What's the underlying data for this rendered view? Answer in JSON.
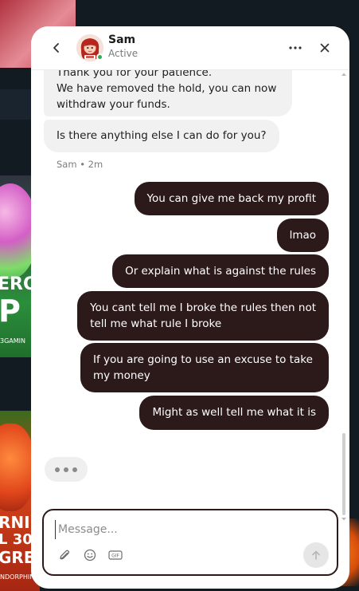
{
  "background": {
    "tile1_lines": [
      "ERO",
      "P",
      "3GAMIN"
    ],
    "tile2_lines": [
      "RNI",
      "L 30",
      "GRE",
      "NDORPHIN"
    ]
  },
  "header": {
    "agent_name": "Sam",
    "agent_status": "Active",
    "back_icon": "chevron-left-icon",
    "more_icon": "more-horizontal-icon",
    "close_icon": "close-icon"
  },
  "messages": {
    "incoming": [
      {
        "lines": [
          "Thank you for your patience.",
          "We have removed the hold, you can now",
          "withdraw your funds."
        ]
      },
      {
        "lines": [
          "Is there anything else I can do for you?"
        ]
      }
    ],
    "incoming_meta": "Sam • 2m",
    "outgoing": [
      {
        "lines": [
          "You can give me back my profit"
        ]
      },
      {
        "lines": [
          "lmao"
        ]
      },
      {
        "lines": [
          "Or explain what is against the rules"
        ]
      },
      {
        "lines": [
          "You cant tell me I broke the rules then not",
          "tell me what rule I broke"
        ]
      },
      {
        "lines": [
          "If you are going to use an excuse to take",
          "my money"
        ]
      },
      {
        "lines": [
          "Might as well tell me what it is"
        ]
      }
    ]
  },
  "composer": {
    "placeholder": "Message...",
    "value": "",
    "gif_label": "GIF"
  },
  "colors": {
    "outgoing_bubble": "#2c1a1b",
    "incoming_bubble": "#f1f1f1",
    "online": "#2bb24c"
  }
}
